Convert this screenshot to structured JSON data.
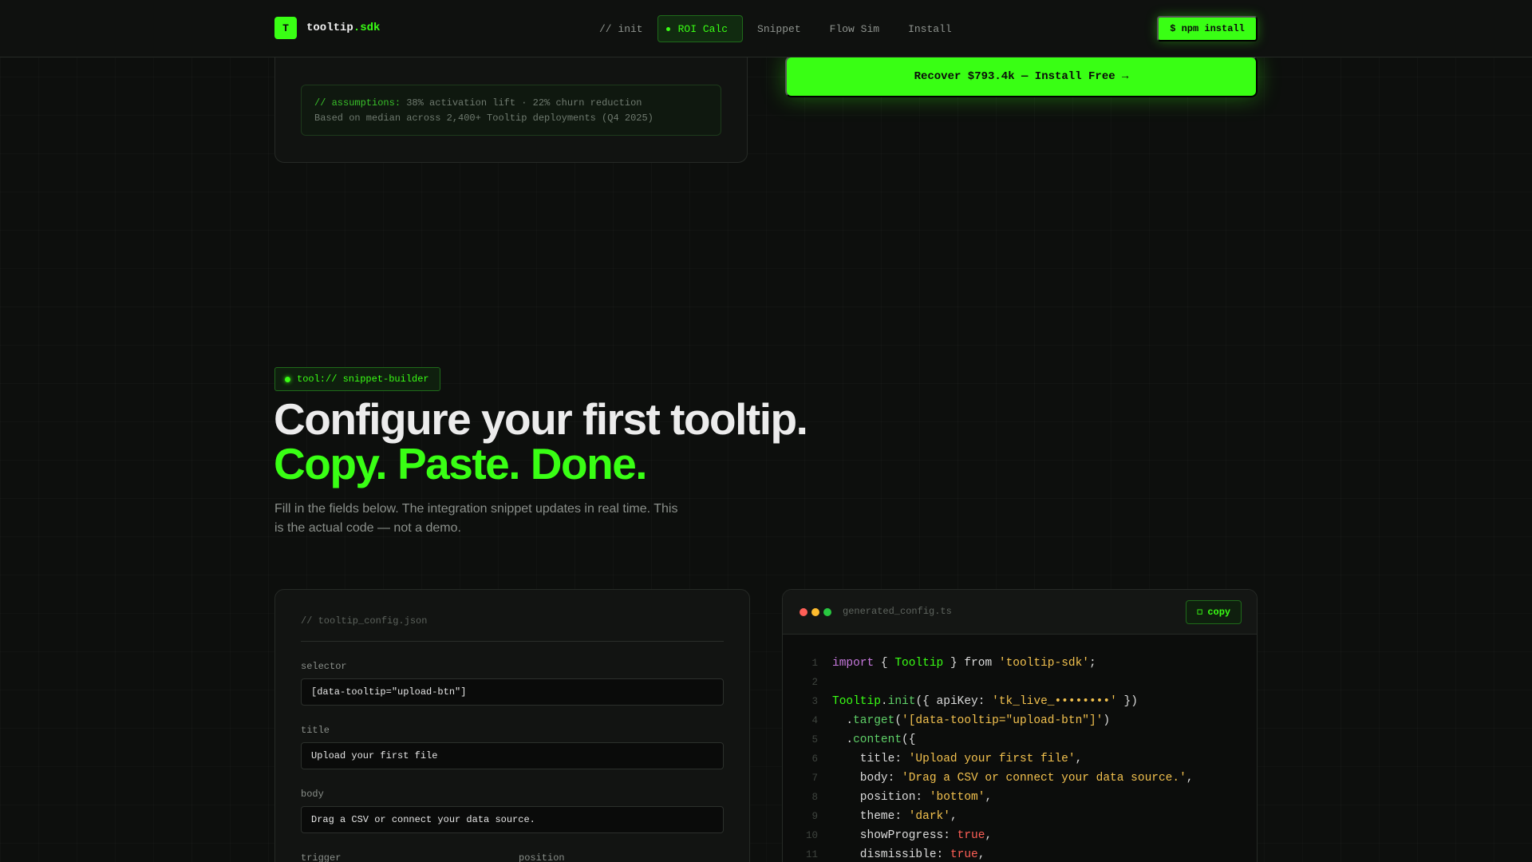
{
  "nav": {
    "logo_letter": "T",
    "logo_name": "tooltip",
    "logo_suffix": ".sdk",
    "items": [
      {
        "label": "// init"
      },
      {
        "label": "ROI Calc",
        "active": true
      },
      {
        "label": "Snippet"
      },
      {
        "label": "Flow Sim"
      },
      {
        "label": "Install"
      }
    ],
    "cta_label": "$ npm install"
  },
  "roi": {
    "assumptions_tag": "// assumptions:",
    "assumptions_text": "38% activation lift · 22% churn reduction",
    "basis_text": "Based on median across 2,400+ Tooltip deployments (Q4 2025)",
    "recover_cta": "Recover $793.4k — Install Free →"
  },
  "snippet": {
    "badge": "tool:// snippet-builder",
    "headline": "Configure your first tooltip.",
    "headline_accent": "Copy. Paste. Done.",
    "lede": "Fill in the fields below. The integration snippet updates in real time. This is the actual code — not a demo."
  },
  "form": {
    "comment": "// tooltip_config.json",
    "fields": {
      "selector": {
        "label": "selector",
        "value": "[data-tooltip=\"upload-btn\"]"
      },
      "title": {
        "label": "title",
        "value": "Upload your first file"
      },
      "body": {
        "label": "body",
        "value": "Drag a CSV or connect your data source."
      },
      "trigger": {
        "label": "trigger"
      },
      "position": {
        "label": "position"
      }
    }
  },
  "code": {
    "filename": "generated_config.ts",
    "copy_label": "copy",
    "copy_icon": "copy-icon",
    "lines": [
      {
        "n": "1",
        "tokens": [
          [
            "kw",
            "import"
          ],
          [
            "pun",
            " { "
          ],
          [
            "cls",
            "Tooltip"
          ],
          [
            "pun",
            " } from "
          ],
          [
            "str",
            "'tooltip-sdk'"
          ],
          [
            "pun",
            ";"
          ]
        ]
      },
      {
        "n": "2",
        "tokens": []
      },
      {
        "n": "3",
        "tokens": [
          [
            "cls",
            "Tooltip"
          ],
          [
            "pun",
            "."
          ],
          [
            "fn",
            "init"
          ],
          [
            "pun",
            "({ apiKey: "
          ],
          [
            "str",
            "'tk_live_••••••••'"
          ],
          [
            "pun",
            " })"
          ]
        ]
      },
      {
        "n": "4",
        "tokens": [
          [
            "pun",
            "  ."
          ],
          [
            "fn",
            "target"
          ],
          [
            "pun",
            "("
          ],
          [
            "str",
            "'[data-tooltip=\"upload-btn\"]'"
          ],
          [
            "pun",
            ")"
          ]
        ]
      },
      {
        "n": "5",
        "tokens": [
          [
            "pun",
            "  ."
          ],
          [
            "fn",
            "content"
          ],
          [
            "pun",
            "({"
          ]
        ]
      },
      {
        "n": "6",
        "tokens": [
          [
            "pun",
            "    title: "
          ],
          [
            "str",
            "'Upload your first file'"
          ],
          [
            "pun",
            ","
          ]
        ]
      },
      {
        "n": "7",
        "tokens": [
          [
            "pun",
            "    body: "
          ],
          [
            "str",
            "'Drag a CSV or connect your data source.'"
          ],
          [
            "pun",
            ","
          ]
        ]
      },
      {
        "n": "8",
        "tokens": [
          [
            "pun",
            "    position: "
          ],
          [
            "str",
            "'bottom'"
          ],
          [
            "pun",
            ","
          ]
        ]
      },
      {
        "n": "9",
        "tokens": [
          [
            "pun",
            "    theme: "
          ],
          [
            "str",
            "'dark'"
          ],
          [
            "pun",
            ","
          ]
        ]
      },
      {
        "n": "10",
        "tokens": [
          [
            "pun",
            "    showProgress: "
          ],
          [
            "bool",
            "true"
          ],
          [
            "pun",
            ","
          ]
        ]
      },
      {
        "n": "11",
        "tokens": [
          [
            "pun",
            "    dismissible: "
          ],
          [
            "bool",
            "true"
          ],
          [
            "pun",
            ","
          ]
        ]
      }
    ]
  },
  "colors": {
    "accent": "#39ff14",
    "background": "#0d0f0d",
    "keyword": "#c678dd",
    "string": "#f2c14e",
    "boolean": "#ff5f56"
  }
}
